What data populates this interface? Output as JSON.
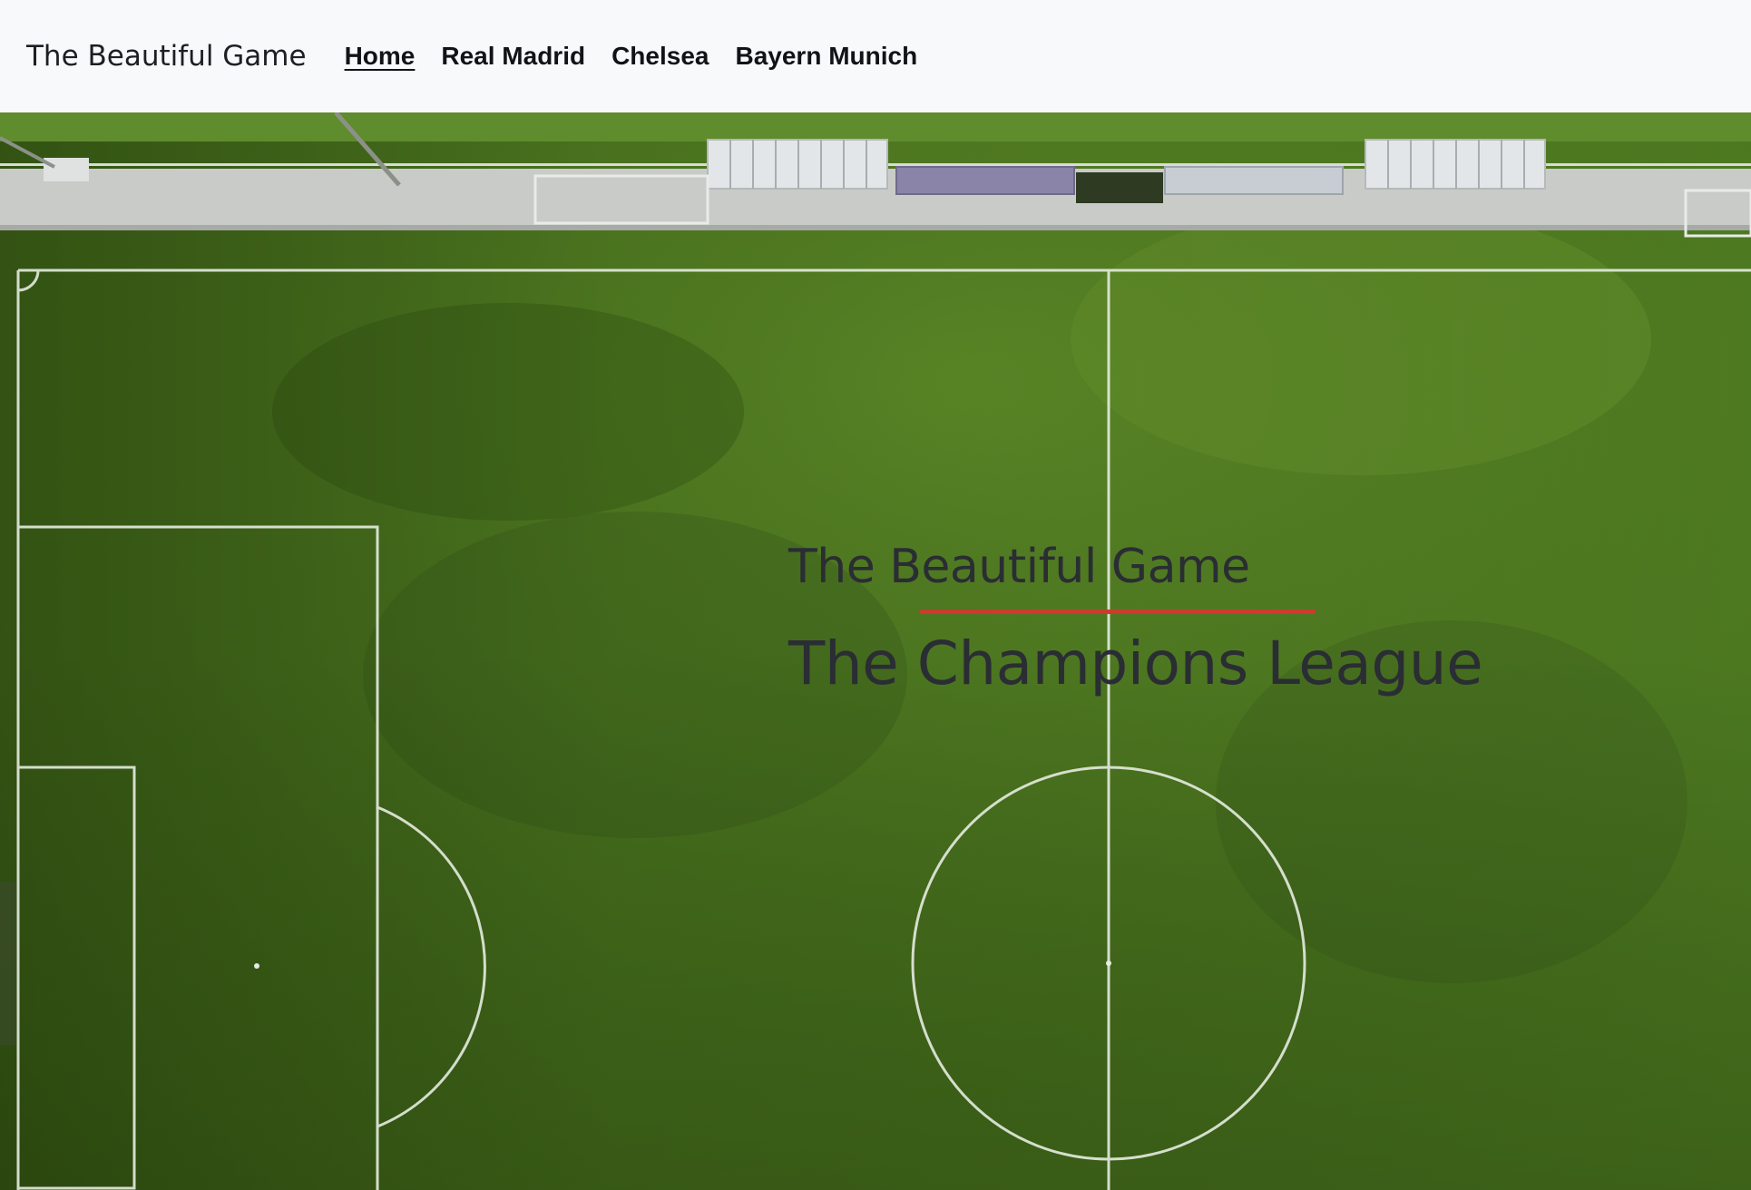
{
  "navbar": {
    "brand": "The Beautiful Game",
    "links": [
      {
        "label": "Home",
        "active": true
      },
      {
        "label": "Real Madrid",
        "active": false
      },
      {
        "label": "Chelsea",
        "active": false
      },
      {
        "label": "Bayern Munich",
        "active": false
      }
    ]
  },
  "hero": {
    "subtitle": "The Beautiful Game",
    "title": "The Champions League",
    "accent_color": "#cf3a2e",
    "background": "aerial-football-pitch-image"
  }
}
